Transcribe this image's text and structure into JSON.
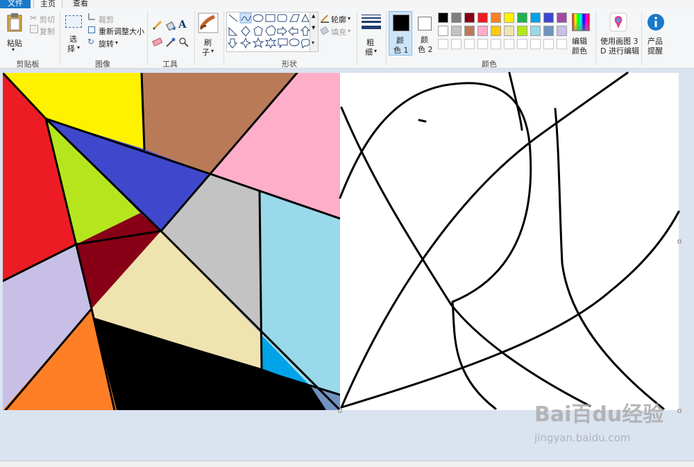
{
  "tabs": {
    "file": "文件",
    "home": "主页",
    "view": "查看"
  },
  "clipboard": {
    "paste": "粘贴",
    "cut": "剪切",
    "copy": "复制",
    "group": "剪贴板"
  },
  "image": {
    "select_1": "选",
    "select_2": "择",
    "crop": "裁剪",
    "resize": "重新调整大小",
    "rotate": "旋转",
    "group": "图像"
  },
  "tools": {
    "group": "工具"
  },
  "brushes": {
    "label_1": "刷",
    "label_2": "子"
  },
  "shapes": {
    "outline": "轮廓",
    "fill": "填充",
    "group": "形状"
  },
  "size": {
    "label_1": "粗",
    "label_2": "细"
  },
  "color1": {
    "label_1": "颜",
    "label_2": "色 1",
    "value": "#000000"
  },
  "color2": {
    "label_1": "颜",
    "label_2": "色 2",
    "value": "#ffffff"
  },
  "palette": {
    "row1": [
      "#000000",
      "#7f7f7f",
      "#880015",
      "#ed1c24",
      "#ff7f27",
      "#fff200",
      "#22b14c",
      "#00a2e8",
      "#3f48cc",
      "#a349a4"
    ],
    "row2": [
      "#ffffff",
      "#c3c3c3",
      "#b97a57",
      "#ffaec9",
      "#ffc90e",
      "#efe4b0",
      "#b5e61d",
      "#99d9ea",
      "#7092be",
      "#c8bfe7"
    ]
  },
  "edit_colors": {
    "label_1": "编辑",
    "label_2": "颜色"
  },
  "colors_group": "颜色",
  "paint3d": {
    "label_1": "使用画图 3",
    "label_2": "D 进行编辑"
  },
  "product_alert": {
    "label_1": "产品",
    "label_2": "提醒"
  },
  "watermark": {
    "logo": "Bai百du经验",
    "url": "jingyan.baidu.com"
  }
}
